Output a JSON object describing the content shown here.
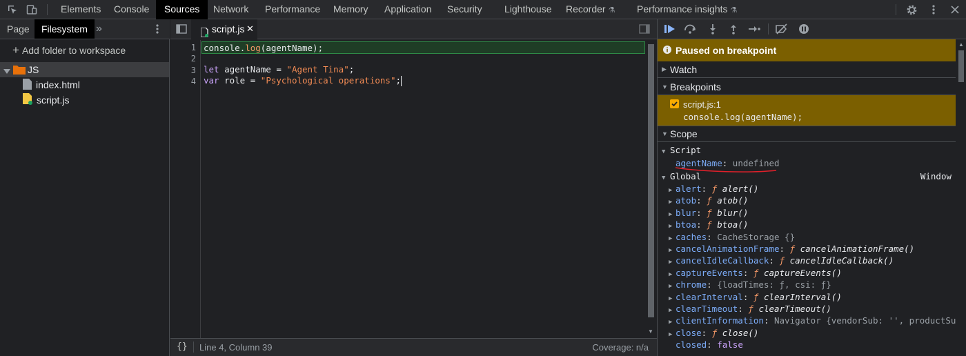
{
  "top_tabs": [
    {
      "label": "Elements",
      "active": false
    },
    {
      "label": "Console",
      "active": false
    },
    {
      "label": "Sources",
      "active": true
    },
    {
      "label": "Network",
      "active": false
    },
    {
      "label": "Performance",
      "active": false
    },
    {
      "label": "Memory",
      "active": false
    },
    {
      "label": "Application",
      "active": false
    },
    {
      "label": "Security",
      "active": false
    },
    {
      "label": "Lighthouse",
      "active": false
    },
    {
      "label": "Recorder",
      "active": false
    },
    {
      "label": "Performance insights",
      "active": false
    }
  ],
  "navigator": {
    "tabs": [
      {
        "label": "Page",
        "active": false
      },
      {
        "label": "Filesystem",
        "active": true
      }
    ],
    "add_folder": "Add folder to workspace",
    "folder": "JS",
    "files": [
      "index.html",
      "script.js"
    ]
  },
  "editor": {
    "tab_label": "script.js",
    "line_numbers": [
      "1",
      "2",
      "3",
      "4"
    ],
    "code": {
      "l1": [
        "console",
        ".",
        "log",
        "(agentName);"
      ],
      "l3": [
        "let",
        " agentName = ",
        "\"Agent Tina\"",
        ";"
      ],
      "l4": [
        "var",
        " role = ",
        "\"Psychological operations\"",
        ";"
      ]
    },
    "status": {
      "pretty_print": "{}",
      "position": "Line 4, Column 39",
      "coverage": "Coverage: n/a"
    }
  },
  "debugger": {
    "paused_banner": "Paused on breakpoint",
    "sections": {
      "watch": "Watch",
      "breakpoints": "Breakpoints",
      "scope": "Scope"
    },
    "breakpoint": {
      "location": "script.js:1",
      "code": "console.log(agentName);",
      "checked": true
    },
    "scope": {
      "script_label": "Script",
      "script_var": {
        "name": "agentName",
        "value": "undefined"
      },
      "global_label": "Global",
      "global_type": "Window",
      "global_items": [
        {
          "name": "alert",
          "kind": "fn",
          "value": "alert()"
        },
        {
          "name": "atob",
          "kind": "fn",
          "value": "atob()"
        },
        {
          "name": "blur",
          "kind": "fn",
          "value": "blur()"
        },
        {
          "name": "btoa",
          "kind": "fn",
          "value": "btoa()"
        },
        {
          "name": "caches",
          "kind": "obj",
          "value": "CacheStorage {}"
        },
        {
          "name": "cancelAnimationFrame",
          "kind": "fn",
          "value": "cancelAnimationFrame()"
        },
        {
          "name": "cancelIdleCallback",
          "kind": "fn",
          "value": "cancelIdleCallback()"
        },
        {
          "name": "captureEvents",
          "kind": "fn",
          "value": "captureEvents()"
        },
        {
          "name": "chrome",
          "kind": "obj",
          "value": "{loadTimes: ƒ, csi: ƒ}"
        },
        {
          "name": "clearInterval",
          "kind": "fn",
          "value": "clearInterval()"
        },
        {
          "name": "clearTimeout",
          "kind": "fn",
          "value": "clearTimeout()"
        },
        {
          "name": "clientInformation",
          "kind": "obj",
          "value": "Navigator {vendorSub: '', productSub: '"
        },
        {
          "name": "close",
          "kind": "fn",
          "value": "close()"
        },
        {
          "name": "closed",
          "kind": "bool",
          "value": "false"
        }
      ]
    }
  },
  "colors": {
    "accent": "#8ab4f8",
    "paused": "#7b5f00",
    "breakpoint_line": "#2e8a46",
    "annotation": "#e0202a"
  }
}
